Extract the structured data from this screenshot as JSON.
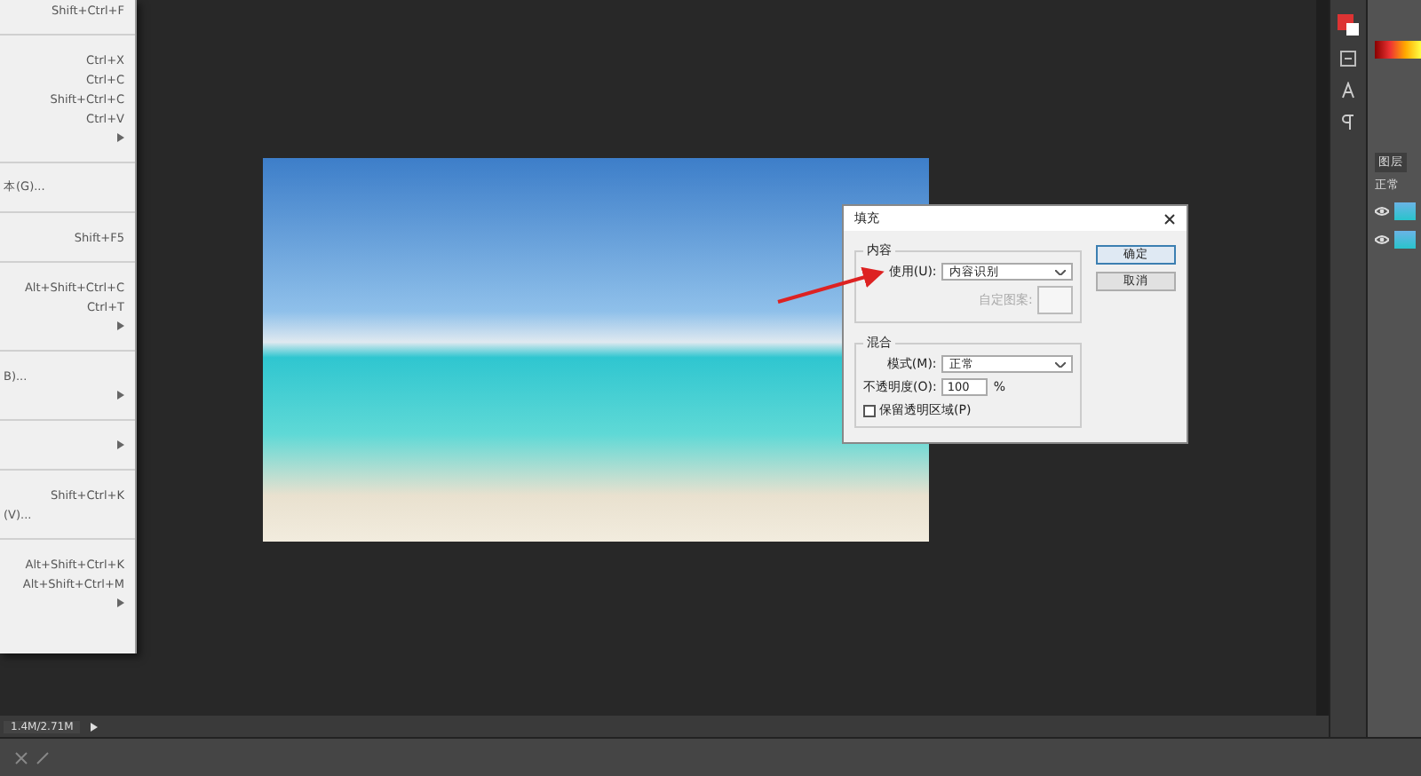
{
  "edit_menu": {
    "items": [
      {
        "kind": "item",
        "shortcut": "Shift+Ctrl+F"
      },
      {
        "kind": "separator"
      },
      {
        "kind": "item",
        "shortcut": "Ctrl+X"
      },
      {
        "kind": "item",
        "shortcut": "Ctrl+C"
      },
      {
        "kind": "item",
        "shortcut": "Shift+Ctrl+C"
      },
      {
        "kind": "item",
        "shortcut": "Ctrl+V"
      },
      {
        "kind": "submenu"
      },
      {
        "kind": "separator"
      },
      {
        "kind": "item",
        "label": "本(G)..."
      },
      {
        "kind": "separator"
      },
      {
        "kind": "item",
        "shortcut": "Shift+F5"
      },
      {
        "kind": "separator"
      },
      {
        "kind": "item",
        "shortcut": "Alt+Shift+Ctrl+C"
      },
      {
        "kind": "item",
        "shortcut": "Ctrl+T"
      },
      {
        "kind": "submenu"
      },
      {
        "kind": "separator"
      },
      {
        "kind": "item",
        "label": "B)..."
      },
      {
        "kind": "submenu"
      },
      {
        "kind": "separator"
      },
      {
        "kind": "submenu"
      },
      {
        "kind": "separator"
      },
      {
        "kind": "item",
        "shortcut": "Shift+Ctrl+K"
      },
      {
        "kind": "item",
        "label": "(V)..."
      },
      {
        "kind": "separator"
      },
      {
        "kind": "item",
        "shortcut": "Alt+Shift+Ctrl+K"
      },
      {
        "kind": "item",
        "shortcut": "Alt+Shift+Ctrl+M"
      },
      {
        "kind": "submenu"
      }
    ]
  },
  "fill_dialog": {
    "title": "填充",
    "contents": {
      "legend": "内容",
      "use_label": "使用(U):",
      "use_value": "内容识别",
      "pattern_label": "自定图案:",
      "pattern_disabled": true
    },
    "blending": {
      "legend": "混合",
      "mode_label": "模式(M):",
      "mode_value": "正常",
      "opacity_label": "不透明度(O):",
      "opacity_value": "100",
      "opacity_unit": "%",
      "preserve_label": "保留透明区域(P)",
      "preserve_checked": false
    },
    "buttons": [
      {
        "label": "确定",
        "default": true
      },
      {
        "label": "取消",
        "default": false
      }
    ]
  },
  "status_bar": {
    "doc_size": "1.4M/2.71M"
  },
  "layers_panel": {
    "tab": "图层",
    "blend_mode": "正常",
    "layers": [
      {
        "visible": true
      },
      {
        "visible": true
      }
    ]
  }
}
